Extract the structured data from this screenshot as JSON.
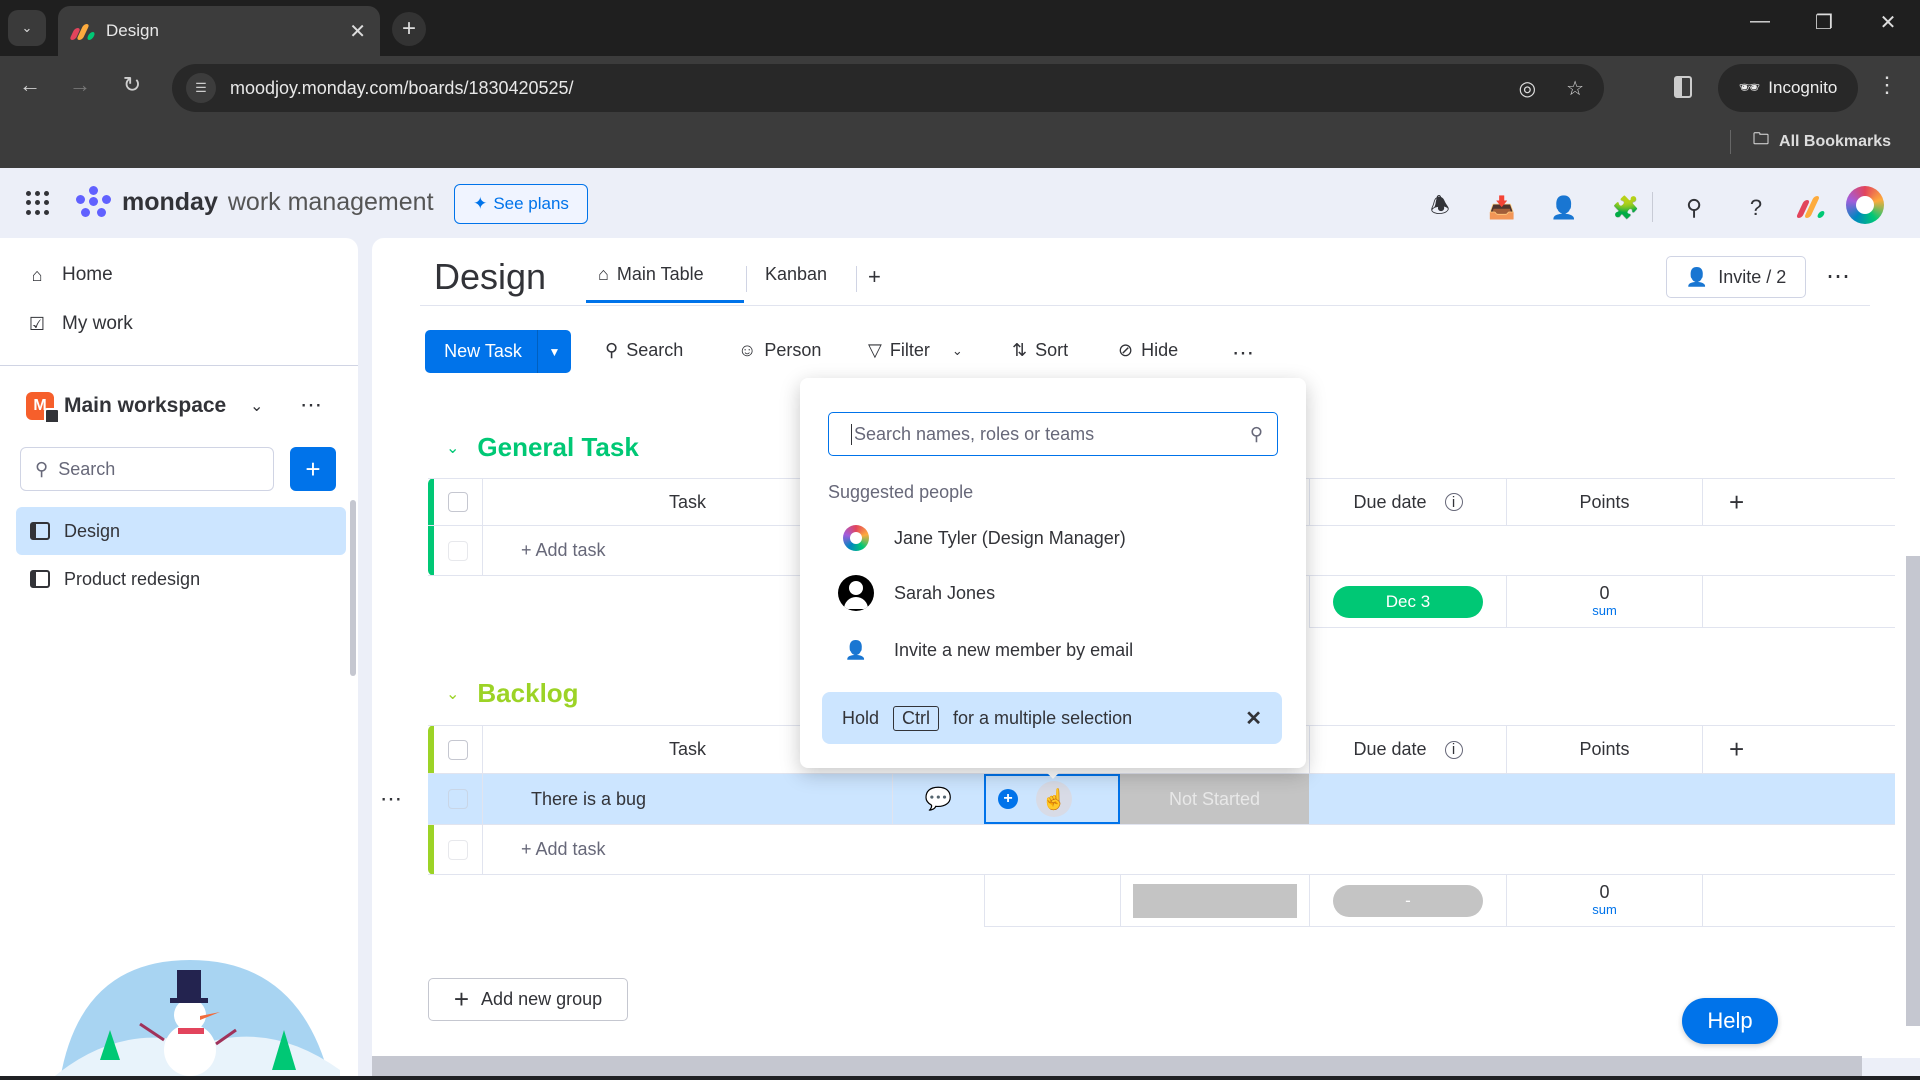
{
  "browser": {
    "tab_title": "Design",
    "url": "moodjoy.monday.com/boards/1830420525/",
    "incognito_label": "Incognito",
    "bookmarks_label": "All Bookmarks",
    "icons": [
      "tab-list-icon",
      "close-tab-icon",
      "new-tab-icon",
      "minimize-icon",
      "restore-icon",
      "close-window-icon",
      "back-icon",
      "forward-icon",
      "reload-icon",
      "site-settings-icon",
      "eye-off-icon",
      "star-icon",
      "side-panel-icon",
      "incognito-icon",
      "menu-icon",
      "folder-icon"
    ]
  },
  "app_header": {
    "brand_bold": "monday",
    "brand_rest": "work management",
    "see_plans_label": "See plans",
    "icons": [
      "notifications-icon",
      "inbox-icon",
      "invite-members-icon",
      "apps-icon",
      "search-icon",
      "help-icon"
    ]
  },
  "sidebar": {
    "nav": [
      {
        "label": "Home",
        "icon": "home-icon"
      },
      {
        "label": "My work",
        "icon": "calendar-check-icon"
      }
    ],
    "workspace": {
      "name": "Main workspace",
      "badge": "M"
    },
    "search_placeholder": "Search",
    "add_label": "+",
    "boards": [
      {
        "label": "Design",
        "active": true
      },
      {
        "label": "Product redesign",
        "active": false
      }
    ]
  },
  "board": {
    "title": "Design",
    "tabs": [
      {
        "label": "Main Table",
        "active": true
      },
      {
        "label": "Kanban",
        "active": false
      }
    ],
    "add_view_label": "+",
    "invite_label": "Invite / 2",
    "toolbar": {
      "new_task_label": "New Task",
      "search_label": "Search",
      "person_label": "Person",
      "filter_label": "Filter",
      "sort_label": "Sort",
      "hide_label": "Hide"
    },
    "columns": {
      "task": "Task",
      "due_date": "Due date",
      "points": "Points",
      "add": "+"
    },
    "groups": [
      {
        "name": "General Task",
        "color": "#00c875",
        "rows": [],
        "add_task_label": "+ Add task",
        "summary": {
          "due_date": "Dec 3",
          "points_value": "0",
          "points_label": "sum"
        }
      },
      {
        "name": "Backlog",
        "color": "#9cd326",
        "rows": [
          {
            "task": "There is a bug",
            "status": "Not Started"
          }
        ],
        "add_task_label": "+ Add task",
        "summary": {
          "due_date": "-",
          "points_value": "0",
          "points_label": "sum"
        }
      }
    ],
    "add_group_label": "Add new group"
  },
  "person_picker": {
    "search_placeholder": "Search names, roles or teams",
    "search_value": "",
    "section_label": "Suggested people",
    "people": [
      {
        "name": "Jane Tyler (Design Manager)",
        "avatar": "colorful-flower-avatar"
      },
      {
        "name": "Sarah Jones",
        "avatar": "default-person-avatar"
      }
    ],
    "invite_label": "Invite a new member by email",
    "tip": {
      "prefix": "Hold",
      "key": "Ctrl",
      "suffix": "for a multiple selection"
    }
  },
  "help_label": "Help",
  "colors": {
    "primary": "#0073ea",
    "selected_row": "#cce5ff",
    "group_general": "#00c875",
    "group_backlog": "#9cd326",
    "status_not_started": "#c4c4c4"
  }
}
